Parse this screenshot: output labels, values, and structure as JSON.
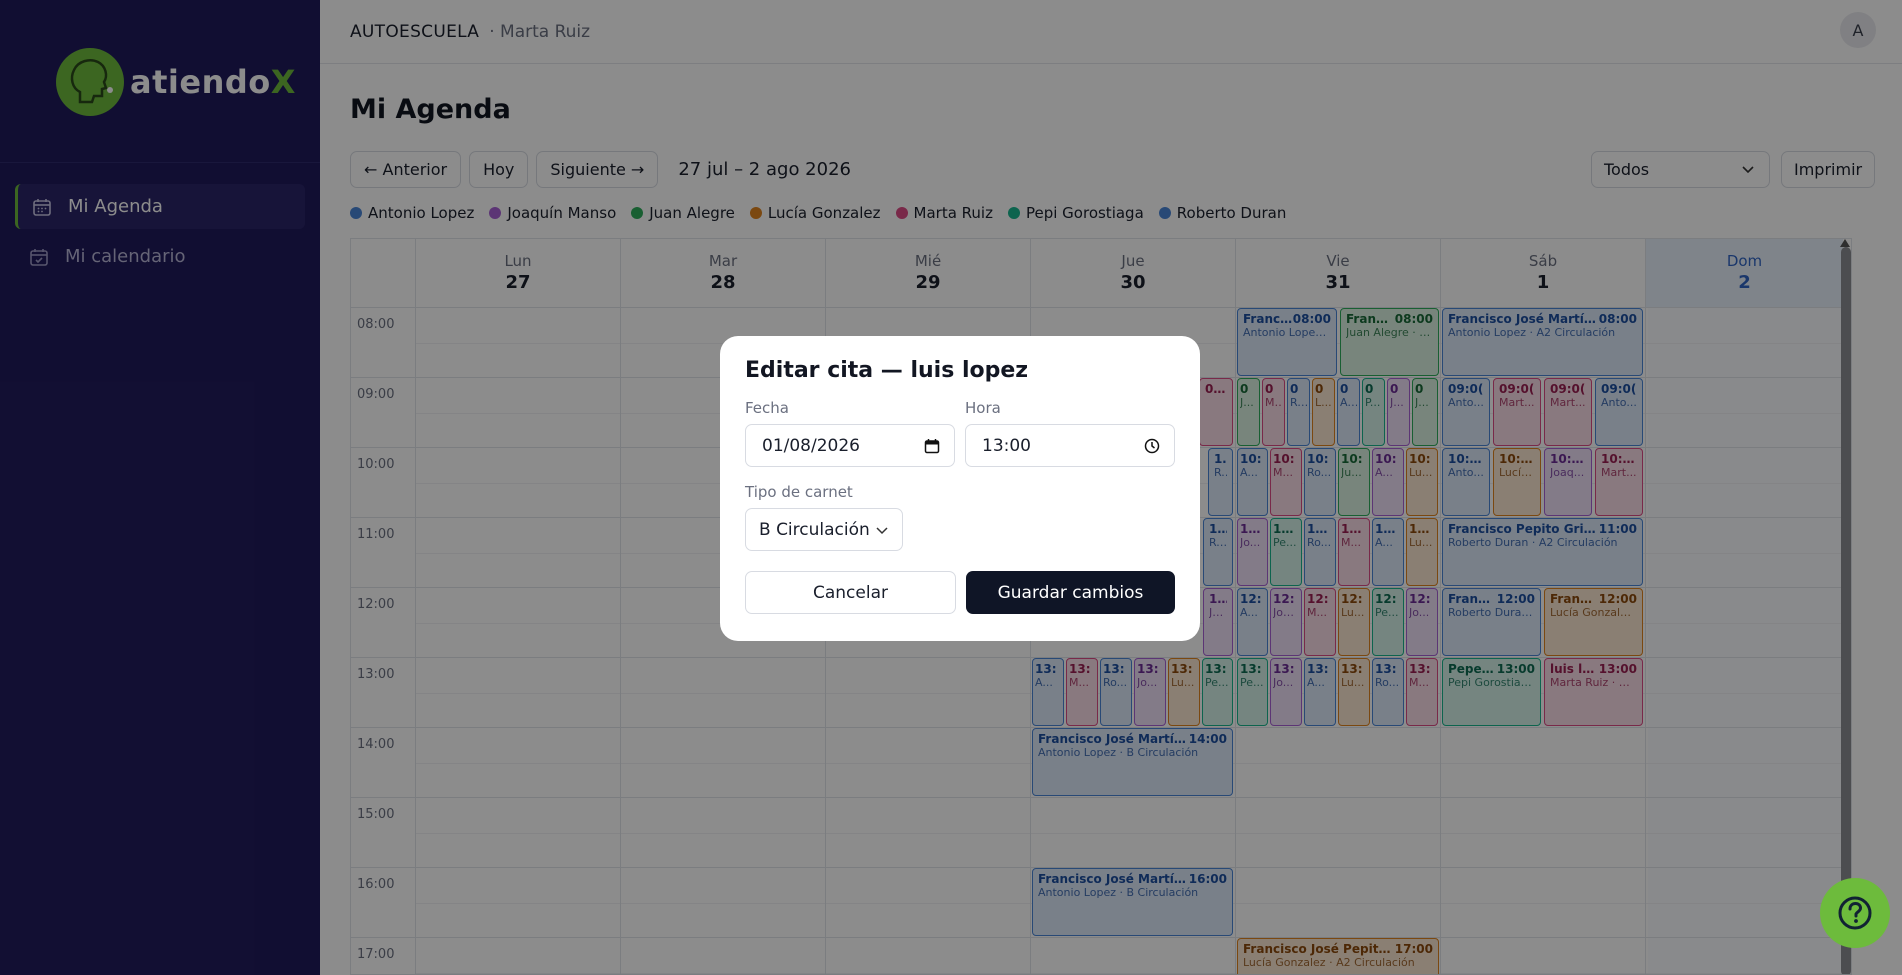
{
  "brand": {
    "name_main": "atiendo",
    "name_x": "X"
  },
  "sidebar": {
    "items": [
      {
        "label": "Mi Agenda",
        "icon": "calendar-icon",
        "active": true
      },
      {
        "label": "Mi calendario",
        "icon": "calendar-check-icon",
        "active": false
      }
    ]
  },
  "topbar": {
    "org": "AUTOESCUELA",
    "user": "· Marta Ruiz",
    "avatar": "A"
  },
  "page": {
    "title": "Mi Agenda"
  },
  "toolbar": {
    "prev": "← Anterior",
    "today": "Hoy",
    "next": "Siguiente →",
    "range": "27 jul – 2 ago 2026",
    "filter": "Todos",
    "print": "Imprimir"
  },
  "legend": [
    {
      "name": "Antonio Lopez",
      "color": "#4a86d8"
    },
    {
      "name": "Joaquín Manso",
      "color": "#a862d6"
    },
    {
      "name": "Juan Alegre",
      "color": "#2fae5c"
    },
    {
      "name": "Lucía Gonzalez",
      "color": "#e0831e"
    },
    {
      "name": "Marta Ruiz",
      "color": "#dc4b85"
    },
    {
      "name": "Pepi Gorostiaga",
      "color": "#18b68f"
    },
    {
      "name": "Roberto Duran",
      "color": "#4a86d8"
    }
  ],
  "calendar": {
    "days": [
      {
        "name": "Lun",
        "num": "27"
      },
      {
        "name": "Mar",
        "num": "28"
      },
      {
        "name": "Mié",
        "num": "29"
      },
      {
        "name": "Jue",
        "num": "30"
      },
      {
        "name": "Vie",
        "num": "31"
      },
      {
        "name": "Sáb",
        "num": "1"
      },
      {
        "name": "Dom",
        "num": "2"
      }
    ],
    "hours": [
      "08:00",
      "09:00",
      "10:00",
      "11:00",
      "12:00",
      "13:00",
      "14:00",
      "15:00",
      "16:00",
      "17:00"
    ],
    "events": {
      "fri_0800_a": {
        "title": "Franci...",
        "time": "08:00",
        "sub": "Antonio Lopez ·..."
      },
      "fri_0800_b": {
        "title": "Franci...",
        "time": "08:00",
        "sub": "Juan Alegre · A..."
      },
      "sat_0800": {
        "title": "Francisco José Martín...",
        "time": "08:00",
        "sub": "Antonio Lopez · A2 Circulación"
      },
      "sat_1100": {
        "title": "Francisco Pepito Grillo",
        "time": "11:00",
        "sub": "Roberto Duran · A2 Circulación"
      },
      "sat_1200_a": {
        "title": "Franci...",
        "time": "12:00",
        "sub": "Roberto Duran ..."
      },
      "sat_1200_b": {
        "title": "Franci...",
        "time": "12:00",
        "sub": "Lucía Gonzalez ..."
      },
      "sat_1300_a": {
        "title": "Pepe R...",
        "time": "13:00",
        "sub": "Pepi Gorostiag..."
      },
      "sat_1300_b": {
        "title": "luis lo...",
        "time": "13:00",
        "sub": "Marta Ruiz · B C..."
      },
      "thu_1400": {
        "title": "Francisco José Martíne...",
        "time": "14:00",
        "sub": "Antonio Lopez · B Circulación"
      },
      "thu_1600": {
        "title": "Francisco José Martíne...",
        "time": "16:00",
        "sub": "Antonio Lopez · B Circulación"
      },
      "fri_1700": {
        "title": "Francisco José Pepito G...",
        "time": "17:00",
        "sub": "Lucía Gonzalez · A2 Circulación"
      },
      "sat_0900_a": {
        "title": "09:0(",
        "sub": "Anto..."
      },
      "sat_0900_b": {
        "title": "09:0(",
        "sub": "Mart..."
      },
      "sat_0900_c": {
        "title": "09:0(",
        "sub": "Mart..."
      },
      "sat_0900_d": {
        "title": "09:0(",
        "sub": "Anto..."
      },
      "sat_1000_a": {
        "title": "10:00",
        "sub": "Anto..."
      },
      "sat_1000_b": {
        "title": "10:00",
        "sub": "Lucía..."
      },
      "sat_1000_c": {
        "title": "10:00",
        "sub": "Joaq..."
      },
      "sat_1000_d": {
        "title": "10:00",
        "sub": "Mart..."
      },
      "thu_0900": {
        "title": "09:00"
      },
      "thu_1300": [
        {
          "t": "13:",
          "s": "A..."
        },
        {
          "t": "13:",
          "s": "M..."
        },
        {
          "t": "13:",
          "s": "Ro..."
        },
        {
          "t": "13:",
          "s": "Jo..."
        },
        {
          "t": "13:",
          "s": "Lu..."
        },
        {
          "t": "13:",
          "s": "Pe..."
        }
      ],
      "fri_0900": [
        {
          "t": "0",
          "s": "J..."
        },
        {
          "t": "0",
          "s": "M..."
        },
        {
          "t": "0",
          "s": "R..."
        },
        {
          "t": "0",
          "s": "L..."
        },
        {
          "t": "0",
          "s": "A..."
        },
        {
          "t": "0",
          "s": "P..."
        },
        {
          "t": "0",
          "s": "J..."
        },
        {
          "t": "0",
          "s": "J..."
        }
      ],
      "fri_1000": [
        {
          "t": "10:",
          "s": "A..."
        },
        {
          "t": "10:",
          "s": "M..."
        },
        {
          "t": "10:",
          "s": "Ro..."
        },
        {
          "t": "10:",
          "s": "Ju..."
        },
        {
          "t": "10:",
          "s": "A..."
        },
        {
          "t": "10:",
          "s": "Lu..."
        }
      ],
      "fri_1100": [
        {
          "t": "11:(",
          "s": "Jo..."
        },
        {
          "t": "11:(",
          "s": "Pe..."
        },
        {
          "t": "11:(",
          "s": "Ro..."
        },
        {
          "t": "11:(",
          "s": "M..."
        },
        {
          "t": "11:(",
          "s": "A..."
        },
        {
          "t": "11:(",
          "s": "Lu..."
        }
      ],
      "fri_1200": [
        {
          "t": "12:",
          "s": "A..."
        },
        {
          "t": "12:",
          "s": "Joa..."
        },
        {
          "t": "12:",
          "s": "M..."
        },
        {
          "t": "12:",
          "s": "Lu..."
        },
        {
          "t": "12:",
          "s": "Pe..."
        },
        {
          "t": "12:",
          "s": "Jo..."
        }
      ],
      "fri_1300": [
        {
          "t": "13:",
          "s": "Pe..."
        },
        {
          "t": "13:",
          "s": "Jo..."
        },
        {
          "t": "13:",
          "s": "A..."
        },
        {
          "t": "13:",
          "s": "Lu..."
        },
        {
          "t": "13:",
          "s": "Ro..."
        },
        {
          "t": "13:",
          "s": "M..."
        }
      ],
      "thu_1000": [
        {
          "t": "10",
          "s": "Ro..."
        }
      ],
      "thu_1100": [
        {
          "t": "11:(",
          "s": "Ro..."
        }
      ],
      "thu_1200": [
        {
          "t": "12:0",
          "s": "Jo..."
        }
      ]
    }
  },
  "modal": {
    "title": "Editar cita — luis lopez",
    "date_label": "Fecha",
    "date_value": "01/08/2026",
    "time_label": "Hora",
    "time_value": "13:00",
    "type_label": "Tipo de carnet",
    "type_value": "B Circulación",
    "cancel": "Cancelar",
    "save": "Guardar cambios"
  }
}
